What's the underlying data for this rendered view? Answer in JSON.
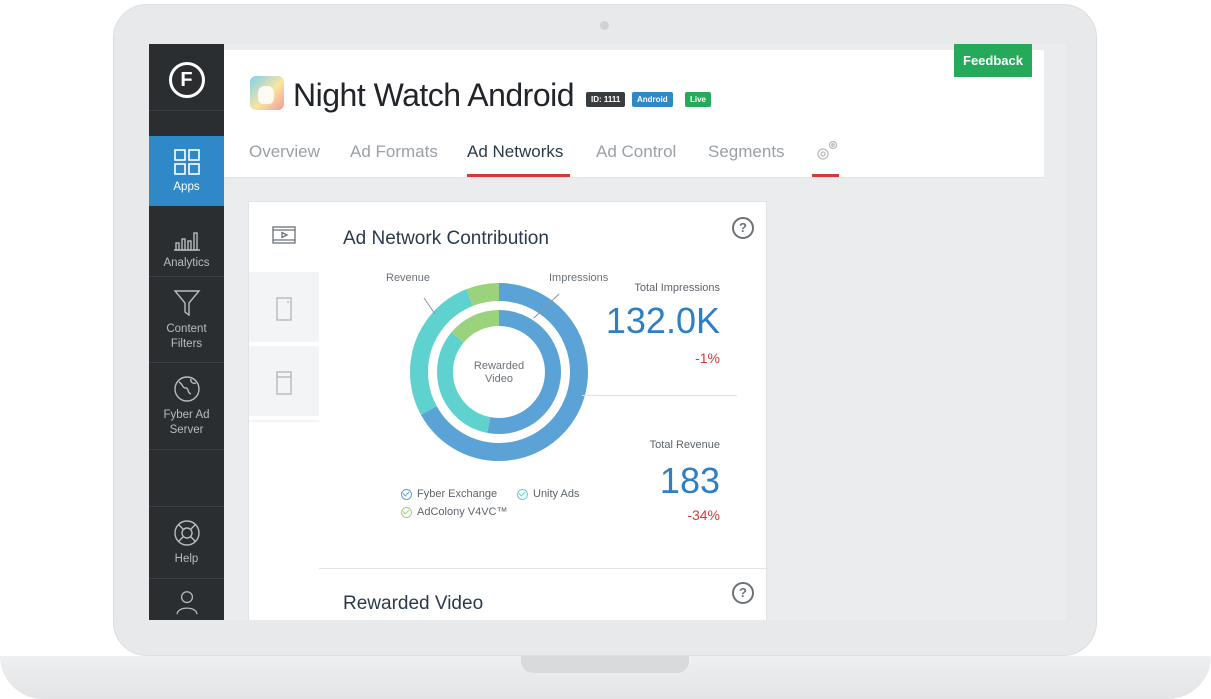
{
  "sidebar": {
    "logo_letter": "F",
    "items": [
      {
        "label": "Apps",
        "icon": "grid-icon"
      },
      {
        "label": "Analytics",
        "icon": "bar-chart-icon"
      },
      {
        "label": "Content Filters",
        "icon": "funnel-icon"
      },
      {
        "label": "Fyber Ad Server",
        "icon": "globe-icon"
      },
      {
        "label": "Help",
        "icon": "lifebuoy-icon"
      },
      {
        "label": "",
        "icon": "user-icon"
      }
    ]
  },
  "header": {
    "app_title": "Night Watch Android",
    "badges": {
      "id": "ID: 1111",
      "platform": "Android",
      "status": "Live"
    },
    "feedback_label": "Feedback",
    "tabs": [
      "Overview",
      "Ad Formats",
      "Ad Networks",
      "Ad Control",
      "Segments"
    ],
    "active_tab": "Ad Networks",
    "settings_icon": "gear-icon"
  },
  "contribution": {
    "title": "Ad Network Contribution",
    "ring_labels": {
      "outer": "Revenue",
      "inner": "Impressions",
      "center": "Rewarded Video"
    },
    "total_impressions_label": "Total Impressions",
    "total_impressions_value": "132.0K",
    "total_impressions_change": "-1%",
    "total_revenue_label": "Total Revenue",
    "total_revenue_value": "183",
    "total_revenue_change": "-34%",
    "legend": [
      {
        "name": "Fyber Exchange",
        "color": "#5ba3d6"
      },
      {
        "name": "Unity Ads",
        "color": "#5fd2d0"
      },
      {
        "name": "AdColony V4VC™",
        "color": "#9bd37c"
      }
    ]
  },
  "rewarded": {
    "title": "Rewarded Video"
  },
  "chart_data": {
    "type": "pie",
    "rings": [
      {
        "name": "Revenue",
        "slices": [
          {
            "label": "Fyber Exchange",
            "value": 67
          },
          {
            "label": "Unity Ads",
            "value": 27
          },
          {
            "label": "AdColony V4VC™",
            "value": 6
          }
        ]
      },
      {
        "name": "Impressions",
        "slices": [
          {
            "label": "Fyber Exchange",
            "value": 53
          },
          {
            "label": "Unity Ads",
            "value": 33
          },
          {
            "label": "AdColony V4VC™",
            "value": 14
          }
        ]
      }
    ],
    "colors": {
      "Fyber Exchange": "#5ba3d6",
      "Unity Ads": "#5fd2d0",
      "AdColony V4VC™": "#9bd37c"
    }
  }
}
